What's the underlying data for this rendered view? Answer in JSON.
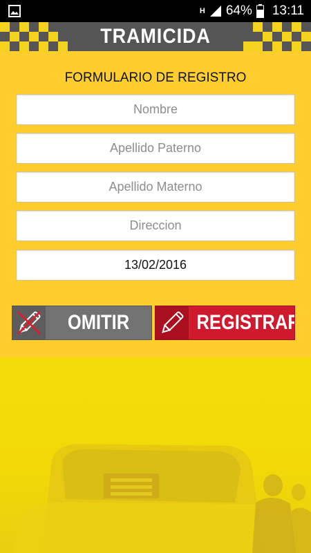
{
  "statusbar": {
    "network": "H",
    "battery": "64%",
    "time": "13:11"
  },
  "header": {
    "title": "TRAMICIDA"
  },
  "form": {
    "title": "FORMULARIO DE REGISTRO",
    "fields": [
      {
        "placeholder": "Nombre",
        "value": ""
      },
      {
        "placeholder": "Apellido Paterno",
        "value": ""
      },
      {
        "placeholder": "Apellido Materno",
        "value": ""
      },
      {
        "placeholder": "Direccion",
        "value": ""
      },
      {
        "placeholder": "",
        "value": "13/02/2016"
      }
    ]
  },
  "buttons": {
    "omit_label": "OMITIR",
    "register_label": "REGISTRAR"
  },
  "colors": {
    "panel": "#fecd2e",
    "header": "#555555",
    "checker_yellow": "#f5d31c",
    "omit_button": "#727272",
    "register_button": "#cf1a2e",
    "background": "#f5dc0a"
  },
  "icons": {
    "status_left": "image-icon",
    "signal": "signal-icon",
    "battery": "battery-icon",
    "omit": "pencil-crossed-icon",
    "register": "pencil-icon"
  }
}
